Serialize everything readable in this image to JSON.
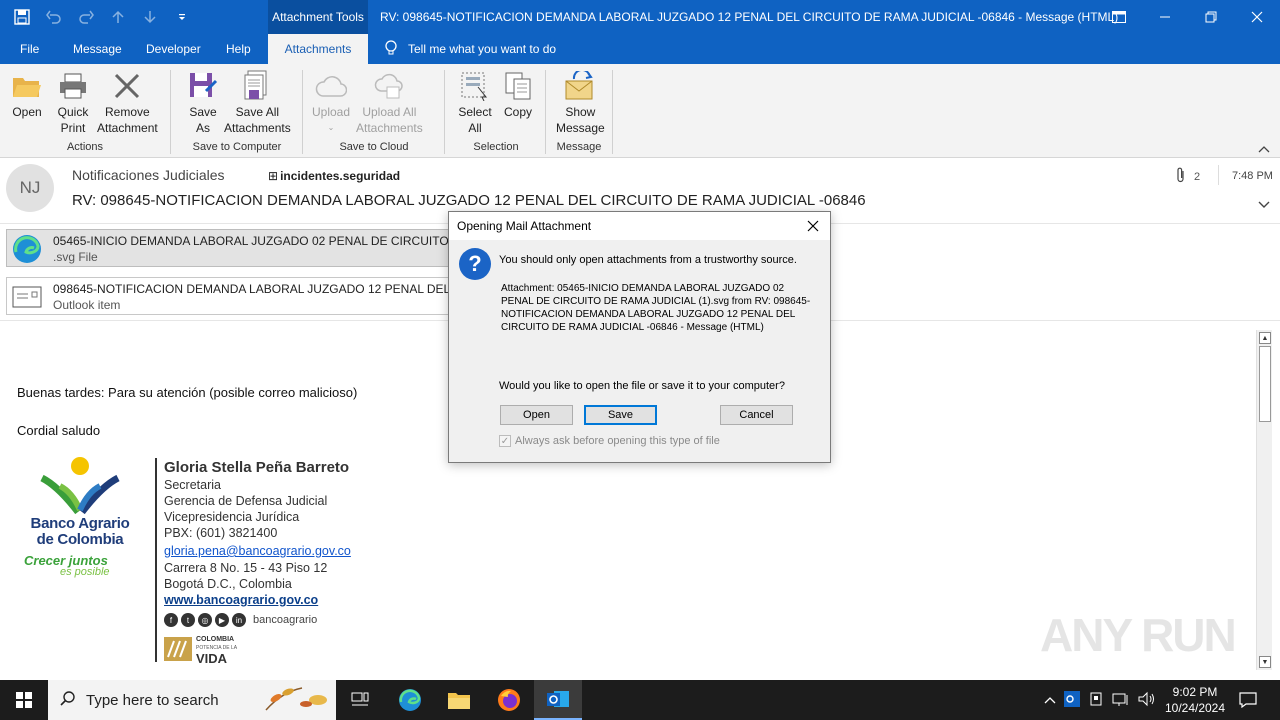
{
  "titlebar": {
    "context_tab": "Attachment Tools",
    "title": "RV: 098645-NOTIFICACION DEMANDA LABORAL JUZGADO 12 PENAL DEL CIRCUITO DE RAMA JUDICIAL -06846  -  Message (HTML)"
  },
  "tabs": [
    "File",
    "Message",
    "Developer",
    "Help",
    "Attachments"
  ],
  "tell_me": "Tell me what you want to do",
  "ribbon": {
    "open": "Open",
    "quick_print": [
      "Quick",
      "Print"
    ],
    "remove_attachment": [
      "Remove",
      "Attachment"
    ],
    "save_as": [
      "Save",
      "As"
    ],
    "save_all": [
      "Save All",
      "Attachments"
    ],
    "upload": "Upload",
    "upload_all": [
      "Upload All",
      "Attachments"
    ],
    "select_all": [
      "Select",
      "All"
    ],
    "copy": "Copy",
    "show_message": [
      "Show",
      "Message"
    ],
    "groups": [
      "Actions",
      "Save to Computer",
      "Save to Cloud",
      "Selection",
      "Message"
    ]
  },
  "message": {
    "avatar_initials": "NJ",
    "sender": "Notificaciones Judiciales",
    "to": "incidentes.seguridad",
    "subject": "RV: 098645-NOTIFICACION DEMANDA LABORAL JUZGADO 12 PENAL DEL CIRCUITO DE RAMA JUDICIAL -06846",
    "attachment_count": "2",
    "time": "7:48 PM"
  },
  "attachments": [
    {
      "name": "05465-INICIO DEMANDA LABORAL JUZGADO 02 PENAL DE CIRCUITO DE RAMA JUDICIAL (1).svg",
      "type": ".svg File"
    },
    {
      "name": "098645-NOTIFICACION DEMANDA LABORAL JUZGADO 12 PENAL DEL CIRCUITO DE RAMA JUDICIAL -06846",
      "type": "Outlook item"
    }
  ],
  "body": {
    "greeting": "Buenas tardes: Para su atención (posible correo malicioso)",
    "closing": "Cordial saludo"
  },
  "signature": {
    "name": "Gloria Stella Peña Barreto",
    "lines": [
      "Secretaria",
      "Gerencia de Defensa Judicial",
      "Vicepresidencia Jurídica",
      "PBX: (601) 3821400"
    ],
    "email": "gloria.pena@bancoagrario.gov.co",
    "address1": "Carrera  8 No. 15 - 43 Piso 12",
    "address2": "Bogotá D.C., Colombia",
    "website": "www.bancoagrario.gov.co",
    "social_handle": "bancoagrario",
    "logo_name": "Banco Agrario de Colombia",
    "logo_tagline1": "Crecer juntos",
    "logo_tagline2": "es posible",
    "vida_line1": "COLOMBIA",
    "vida_line2": "POTENCIA DE LA",
    "vida_line3": "VIDA"
  },
  "dialog": {
    "title": "Opening Mail Attachment",
    "warning": "You should only open attachments from a trustworthy source.",
    "detail": "Attachment: 05465-INICIO DEMANDA LABORAL JUZGADO 02 PENAL DE CIRCUITO DE RAMA JUDICIAL (1).svg from RV: 098645-NOTIFICACION DEMANDA LABORAL JUZGADO 12 PENAL DEL CIRCUITO DE RAMA JUDICIAL -06846 - Message (HTML)",
    "question": "Would you like to open the file or save it to your computer?",
    "open_label": "Open",
    "save_label": "Save",
    "cancel_label": "Cancel",
    "checkbox_label": "Always ask before opening this type of file"
  },
  "taskbar": {
    "search_placeholder": "Type here to search",
    "time": "9:02 PM",
    "date": "10/24/2024"
  },
  "watermark": "ANY RUN",
  "colors": {
    "accent": "#0f62c2",
    "tab_text": "#1a5fb4",
    "dialog_button_focus": "#0078d7"
  }
}
